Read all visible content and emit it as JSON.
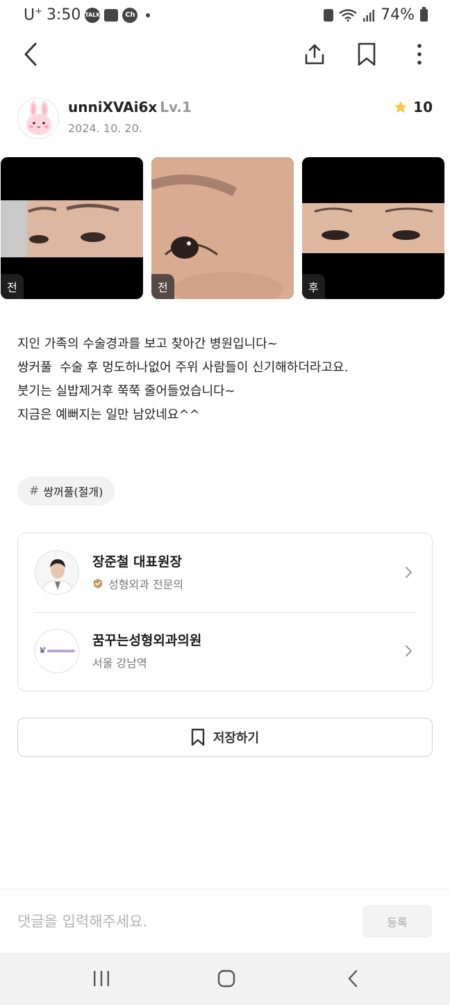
{
  "status_bar": {
    "carrier": "U",
    "carrier_sup": "+",
    "time": "3:50",
    "talk_label": "TALK",
    "ch_label": "Ch",
    "battery": "74%"
  },
  "author": {
    "username": "unniXVAi6x",
    "level": "Lv.1",
    "date": "2024. 10. 20.",
    "rating": "10"
  },
  "photos": [
    {
      "tag": "전"
    },
    {
      "tag": "전"
    },
    {
      "tag": "후"
    }
  ],
  "post": {
    "lines": [
      "지인 가족의 수술경과를 보고 찾아간 병원입니다~",
      "쌍커풀  수술 후 멍도하나없어 주위 사람들이 신기해하더라고요.",
      "붓기는 실밥제거후 쭉쭉 줄어들었습니다~",
      "지금은 예뻐지는 일만 남았네요^^"
    ]
  },
  "hashtag": {
    "symbol": "#",
    "label": "쌍꺼풀(절개)"
  },
  "doctor": {
    "name": "장준철 대표원장",
    "specialty": "성형외과 전문의"
  },
  "clinic": {
    "name": "꿈꾸는성형외과의원",
    "location": "서울 강남역",
    "logo_text": "꿈꾸는성형외과"
  },
  "save_button": {
    "label": "저장하기"
  },
  "comment": {
    "placeholder": "댓글을 입력해주세요.",
    "submit_label": "등록"
  },
  "colors": {
    "star": "#F5C842",
    "badge": "#C49A5E",
    "text_primary": "#222222",
    "text_muted": "#8A8A8A"
  }
}
